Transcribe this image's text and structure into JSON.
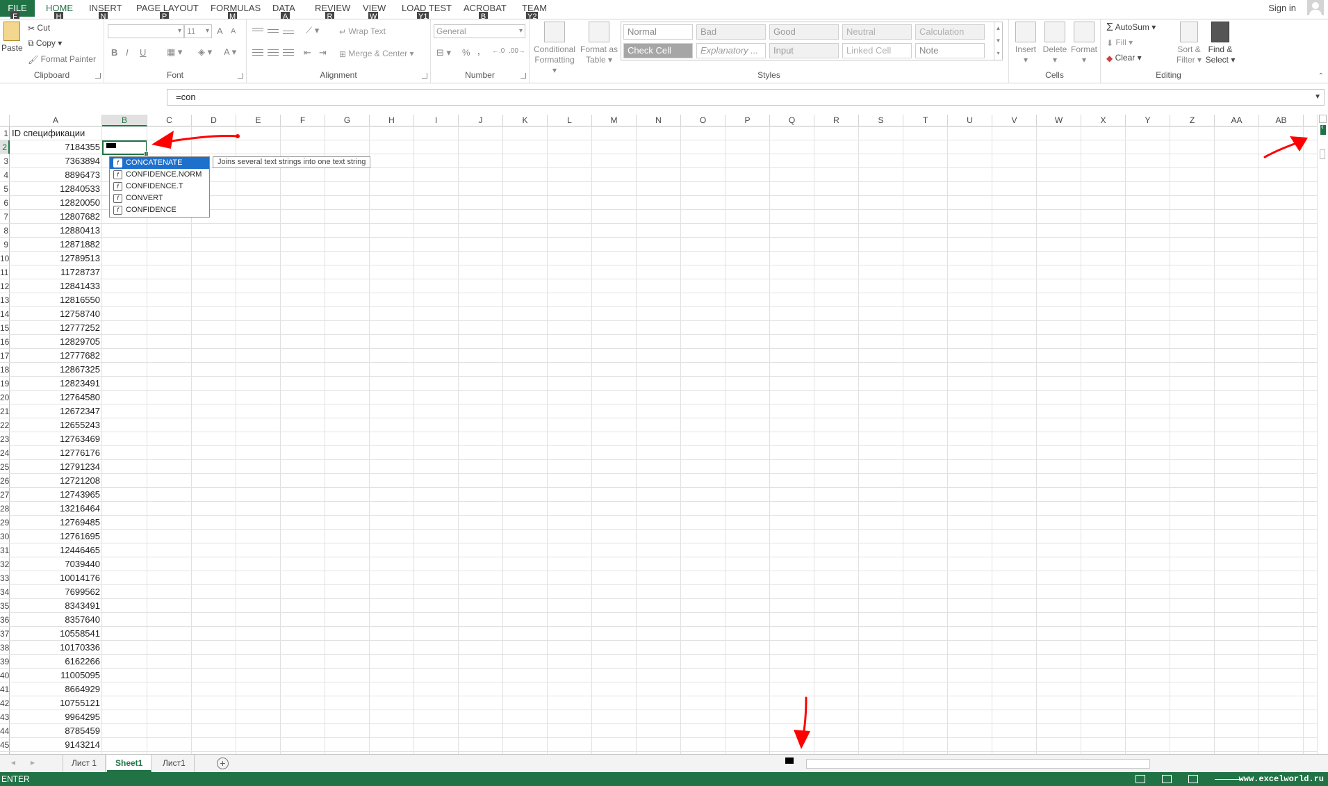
{
  "ribbon_tabs": [
    {
      "label": "FILE",
      "key": "F"
    },
    {
      "label": "HOME",
      "key": "H"
    },
    {
      "label": "INSERT",
      "key": "N"
    },
    {
      "label": "PAGE LAYOUT",
      "key": "P"
    },
    {
      "label": "FORMULAS",
      "key": "M"
    },
    {
      "label": "DATA",
      "key": "A"
    },
    {
      "label": "REVIEW",
      "key": "R"
    },
    {
      "label": "VIEW",
      "key": "W"
    },
    {
      "label": "LOAD TEST",
      "key": "Y1"
    },
    {
      "label": "ACROBAT",
      "key": "B"
    },
    {
      "label": "TEAM",
      "key": "Y2"
    }
  ],
  "signin": "Sign in",
  "clipboard": {
    "paste": "Paste",
    "cut": "Cut",
    "copy": "Copy",
    "format_painter": "Format Painter",
    "group": "Clipboard"
  },
  "font": {
    "size": "11",
    "group": "Font",
    "bold": "B",
    "italic": "I",
    "underline": "U",
    "grow": "A",
    "shrink": "A",
    "color": "A"
  },
  "alignment": {
    "wrap": "Wrap Text",
    "merge": "Merge & Center",
    "group": "Alignment"
  },
  "number": {
    "format": "General",
    "percent": "%",
    "comma": ",",
    "group": "Number"
  },
  "styles": {
    "conditional": "Conditional Formatting",
    "format_table": "Format as Table",
    "group": "Styles",
    "items": [
      {
        "label": "Normal",
        "bg": "#ffffff",
        "fg": "#8a8a8a"
      },
      {
        "label": "Bad",
        "bg": "#f1f1f1",
        "fg": "#9a9a9a"
      },
      {
        "label": "Good",
        "bg": "#f1f1f1",
        "fg": "#9a9a9a"
      },
      {
        "label": "Neutral",
        "bg": "#f1f1f1",
        "fg": "#b0b0b0"
      },
      {
        "label": "Calculation",
        "bg": "#f1f1f1",
        "fg": "#b0b0b0"
      },
      {
        "label": "Check Cell",
        "bg": "#a6a6a6",
        "fg": "#ffffff"
      },
      {
        "label": "Explanatory ...",
        "bg": "#ffffff",
        "fg": "#9a9a9a"
      },
      {
        "label": "Input",
        "bg": "#f1f1f1",
        "fg": "#9a9a9a"
      },
      {
        "label": "Linked Cell",
        "bg": "#ffffff",
        "fg": "#b0b0b0"
      },
      {
        "label": "Note",
        "bg": "#ffffff",
        "fg": "#8a8a8a"
      }
    ]
  },
  "cells": {
    "insert": "Insert",
    "delete": "Delete",
    "format": "Format",
    "group": "Cells"
  },
  "editing": {
    "autosum": "AutoSum",
    "fill": "Fill",
    "clear": "Clear",
    "sort": "Sort & Filter",
    "find": "Find & Select",
    "group": "Editing"
  },
  "formula": "=con",
  "columns": [
    "A",
    "B",
    "C",
    "D",
    "E",
    "F",
    "G",
    "H",
    "I",
    "J",
    "K",
    "L",
    "M",
    "N",
    "O",
    "P",
    "Q",
    "R",
    "S",
    "T",
    "U",
    "V",
    "W",
    "X",
    "Y",
    "Z",
    "AA",
    "AB"
  ],
  "row_numbers": [
    "1",
    "2",
    "3",
    "4",
    "5",
    "6",
    "7",
    "8",
    "9",
    "10",
    "11",
    "12",
    "13",
    "14",
    "15",
    "16",
    "17",
    "18",
    "19",
    "20",
    "21",
    "22",
    "23",
    "24",
    "25",
    "26",
    "27",
    "28",
    "29",
    "30",
    "31",
    "32",
    "33",
    "34",
    "35",
    "36",
    "37",
    "38",
    "39",
    "40",
    "41",
    "42",
    "43",
    "44",
    "45"
  ],
  "column_a_header": "ID спецификации",
  "column_a": [
    "7184355",
    "7363894",
    "8896473",
    "12840533",
    "12820050",
    "12807682",
    "12880413",
    "12871882",
    "12789513",
    "11728737",
    "12841433",
    "12816550",
    "12758740",
    "12777252",
    "12829705",
    "12777682",
    "12867325",
    "12823491",
    "12764580",
    "12672347",
    "12655243",
    "12763469",
    "12776176",
    "12791234",
    "12721208",
    "12743965",
    "13216464",
    "12769485",
    "12761695",
    "12446465",
    "7039440",
    "10014176",
    "7699562",
    "8343491",
    "8357640",
    "10558541",
    "10170336",
    "6162266",
    "11005095",
    "8664929",
    "10755121",
    "9964295",
    "8785459",
    "9143214"
  ],
  "autocomplete": {
    "items": [
      "CONCATENATE",
      "CONFIDENCE.NORM",
      "CONFIDENCE.T",
      "CONVERT",
      "CONFIDENCE"
    ],
    "tooltip": "Joins several text strings into one text string"
  },
  "sheet_tabs": [
    "Лист 1",
    "Sheet1",
    "Лист1"
  ],
  "status_mode": "ENTER",
  "watermark": "www.excelworld.ru",
  "colors": {
    "excel_green": "#217346",
    "annotation_red": "#ff0000",
    "selection_blue": "#1e70cd"
  }
}
